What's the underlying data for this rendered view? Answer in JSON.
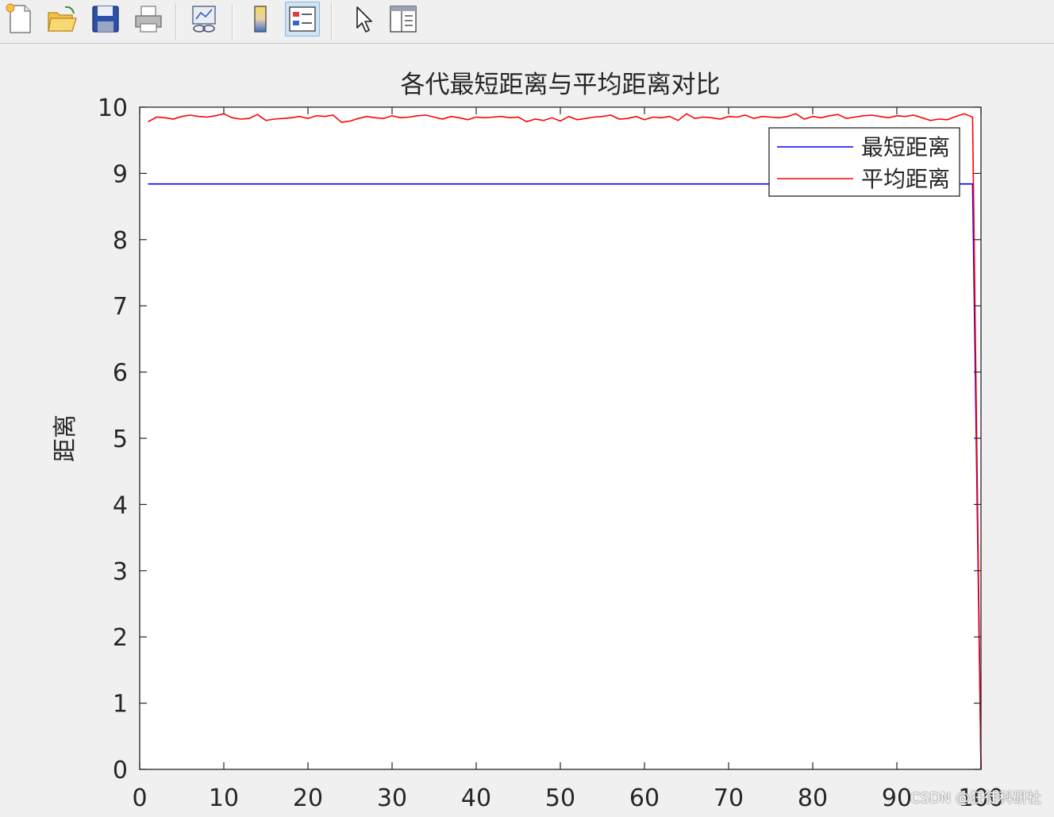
{
  "toolbar": {
    "buttons": [
      {
        "name": "new-figure-icon"
      },
      {
        "name": "open-file-icon"
      },
      {
        "name": "save-icon"
      },
      {
        "name": "print-icon"
      },
      {
        "name": "link-plot-icon"
      },
      {
        "name": "colorbar-icon"
      },
      {
        "name": "legend-icon",
        "active": true
      },
      {
        "name": "edit-plot-icon"
      },
      {
        "name": "property-editor-icon"
      }
    ]
  },
  "chart_data": {
    "type": "line",
    "title": "各代最短距离与平均距离对比",
    "xlabel": "",
    "ylabel": "距离",
    "xlim": [
      0,
      100
    ],
    "ylim": [
      0,
      10
    ],
    "xticks": [
      "0",
      "10",
      "20",
      "30",
      "40",
      "50",
      "60",
      "70",
      "80",
      "90",
      "100"
    ],
    "yticks": [
      "0",
      "1",
      "2",
      "3",
      "4",
      "5",
      "6",
      "7",
      "8",
      "9",
      "10"
    ],
    "grid": false,
    "legend_position": "top-right",
    "series": [
      {
        "name": "最短距离",
        "color": "#0000ff",
        "x": [
          1,
          99,
          100
        ],
        "y": [
          8.84,
          8.84,
          0
        ]
      },
      {
        "name": "平均距离",
        "color": "#ff0000",
        "x": [
          1,
          2,
          3,
          4,
          5,
          6,
          7,
          8,
          9,
          10,
          11,
          12,
          13,
          14,
          15,
          16,
          17,
          18,
          19,
          20,
          21,
          22,
          23,
          24,
          25,
          26,
          27,
          28,
          29,
          30,
          31,
          32,
          33,
          34,
          35,
          36,
          37,
          38,
          39,
          40,
          41,
          42,
          43,
          44,
          45,
          46,
          47,
          48,
          49,
          50,
          51,
          52,
          53,
          54,
          55,
          56,
          57,
          58,
          59,
          60,
          61,
          62,
          63,
          64,
          65,
          66,
          67,
          68,
          69,
          70,
          71,
          72,
          73,
          74,
          75,
          76,
          77,
          78,
          79,
          80,
          81,
          82,
          83,
          84,
          85,
          86,
          87,
          88,
          89,
          90,
          91,
          92,
          93,
          94,
          95,
          96,
          97,
          98,
          99,
          100
        ],
        "y": [
          9.78,
          9.85,
          9.84,
          9.82,
          9.86,
          9.88,
          9.86,
          9.85,
          9.87,
          9.9,
          9.84,
          9.82,
          9.83,
          9.89,
          9.8,
          9.82,
          9.83,
          9.84,
          9.86,
          9.83,
          9.87,
          9.86,
          9.88,
          9.77,
          9.79,
          9.83,
          9.86,
          9.84,
          9.83,
          9.87,
          9.84,
          9.85,
          9.87,
          9.88,
          9.85,
          9.82,
          9.86,
          9.84,
          9.81,
          9.85,
          9.84,
          9.85,
          9.86,
          9.84,
          9.85,
          9.78,
          9.82,
          9.8,
          9.84,
          9.79,
          9.86,
          9.81,
          9.83,
          9.85,
          9.86,
          9.88,
          9.82,
          9.83,
          9.86,
          9.81,
          9.85,
          9.84,
          9.86,
          9.8,
          9.9,
          9.83,
          9.85,
          9.84,
          9.82,
          9.86,
          9.85,
          9.88,
          9.83,
          9.86,
          9.85,
          9.84,
          9.86,
          9.9,
          9.82,
          9.86,
          9.84,
          9.87,
          9.89,
          9.83,
          9.85,
          9.87,
          9.88,
          9.86,
          9.84,
          9.87,
          9.86,
          9.88,
          9.84,
          9.8,
          9.82,
          9.81,
          9.86,
          9.9,
          9.85,
          0
        ]
      }
    ]
  },
  "watermark": "CSDN @狂徒科研社"
}
